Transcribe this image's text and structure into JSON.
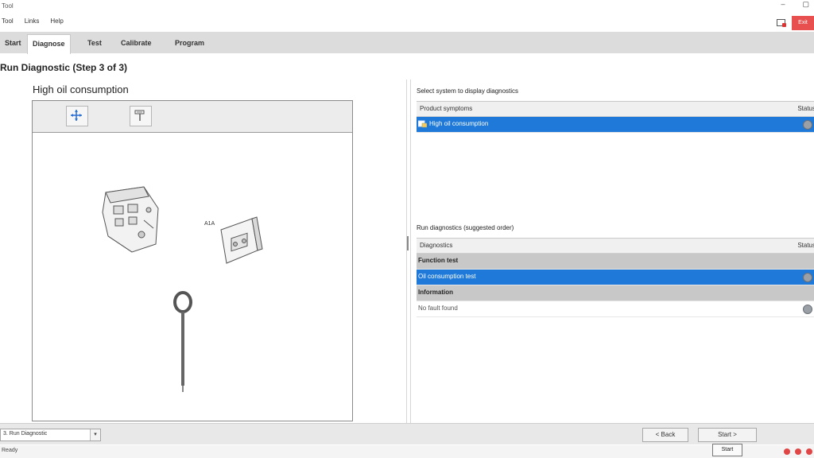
{
  "window": {
    "title": "Tool",
    "minimize_glyph": "–",
    "maximize_glyph": "▢"
  },
  "menu": [
    "Tool",
    "Links",
    "Help"
  ],
  "top_right": {
    "button_label": "Exit"
  },
  "tabs": [
    {
      "label": "Start",
      "active": false
    },
    {
      "label": "Diagnose",
      "active": true
    },
    {
      "label": "Test",
      "active": false
    },
    {
      "label": "Calibrate",
      "active": false
    },
    {
      "label": "Program",
      "active": false
    }
  ],
  "page_title": "Run Diagnostic (Step 3 of 3)",
  "left_pane": {
    "symptom_title": "High oil consumption",
    "callout_label": "A1A"
  },
  "right_pane": {
    "systems_label": "Select system to display diagnostics",
    "systems_columns": [
      "Product symptoms",
      "Status"
    ],
    "systems_rows": [
      {
        "label": "High oil consumption",
        "selected": true
      }
    ],
    "diagnostics_label": "Run diagnostics (suggested order)",
    "diagnostics_columns": [
      "Diagnostics",
      "Status"
    ],
    "diagnostics_rows": [
      {
        "label": "Function test",
        "type": "group"
      },
      {
        "label": "Oil consumption test",
        "type": "item",
        "selected": true
      },
      {
        "label": "Information",
        "type": "group"
      },
      {
        "label": "No fault found",
        "type": "item",
        "selected": false
      }
    ]
  },
  "bottom": {
    "combo_value": "3. Run Diagnostic",
    "combo_arrow": "▾",
    "back_label": "< Back",
    "start_label": "Start >"
  },
  "status": {
    "left_text": "Ready",
    "tooltip": "Start"
  },
  "colors": {
    "selection": "#1e79d8",
    "group_row": "#c8c8c8",
    "exit_button": "#e8504f"
  }
}
